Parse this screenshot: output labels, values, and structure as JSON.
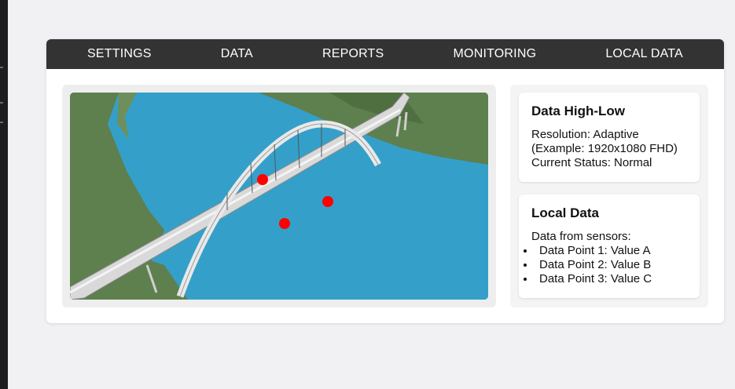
{
  "nav": {
    "items": [
      {
        "label": "SETTINGS"
      },
      {
        "label": "DATA"
      },
      {
        "label": "REPORTS"
      },
      {
        "label": "MONITORING"
      },
      {
        "label": "LOCAL DATA"
      }
    ]
  },
  "map": {
    "marker_color": "#ff0000",
    "water_color": "#34a0c9",
    "land_color": "#5e7f4e"
  },
  "high_low": {
    "title": "Data High-Low",
    "resolution": "Resolution: Adaptive",
    "example": "(Example: 1920x1080 FHD)",
    "status": "Current Status: Normal"
  },
  "local_data": {
    "title": "Local Data",
    "intro": "Data from sensors:",
    "points": [
      "Data Point 1: Value A",
      "Data Point 2: Value B",
      "Data Point 3: Value C"
    ]
  }
}
